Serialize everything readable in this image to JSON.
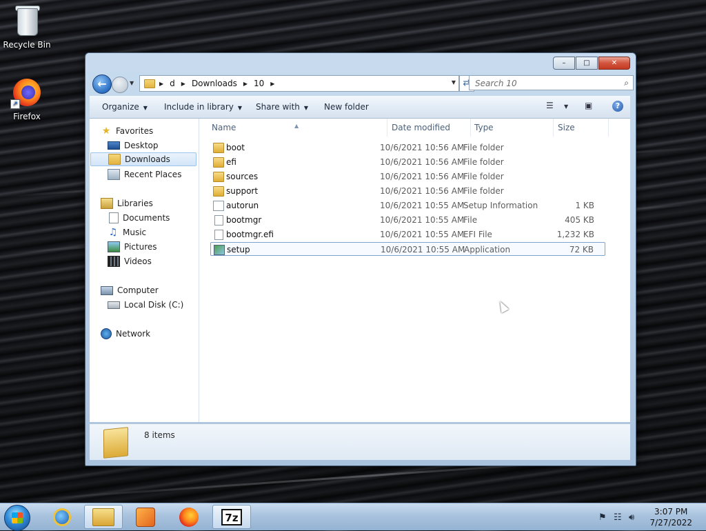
{
  "desktop": {
    "icons": [
      {
        "label": "Recycle Bin",
        "icon": "recycle-bin-icon"
      },
      {
        "label": "Firefox",
        "icon": "firefox-icon"
      }
    ]
  },
  "window": {
    "caption": {
      "min": "–",
      "max": "□",
      "close": "✕"
    },
    "breadcrumb": [
      "d",
      "Downloads",
      "10"
    ],
    "search_placeholder": "Search 10",
    "toolbar": {
      "organize": "Organize",
      "include_in_library": "Include in library",
      "share_with": "Share with",
      "new_folder": "New folder"
    },
    "nav": {
      "favorites": {
        "label": "Favorites",
        "items": [
          "Desktop",
          "Downloads",
          "Recent Places"
        ]
      },
      "libraries": {
        "label": "Libraries",
        "items": [
          "Documents",
          "Music",
          "Pictures",
          "Videos"
        ]
      },
      "computer": {
        "label": "Computer",
        "items": [
          "Local Disk (C:)"
        ]
      },
      "network": {
        "label": "Network"
      },
      "selected": "Downloads"
    },
    "columns": {
      "name": "Name",
      "date": "Date modified",
      "type": "Type",
      "size": "Size"
    },
    "files": [
      {
        "name": "boot",
        "date": "10/6/2021 10:56 AM",
        "type": "File folder",
        "size": "",
        "icon": "folder-icon"
      },
      {
        "name": "efi",
        "date": "10/6/2021 10:56 AM",
        "type": "File folder",
        "size": "",
        "icon": "folder-icon"
      },
      {
        "name": "sources",
        "date": "10/6/2021 10:56 AM",
        "type": "File folder",
        "size": "",
        "icon": "folder-icon"
      },
      {
        "name": "support",
        "date": "10/6/2021 10:56 AM",
        "type": "File folder",
        "size": "",
        "icon": "folder-icon"
      },
      {
        "name": "autorun",
        "date": "10/6/2021 10:55 AM",
        "type": "Setup Information",
        "size": "1 KB",
        "icon": "setup-info-icon"
      },
      {
        "name": "bootmgr",
        "date": "10/6/2021 10:55 AM",
        "type": "File",
        "size": "405 KB",
        "icon": "file-icon"
      },
      {
        "name": "bootmgr.efi",
        "date": "10/6/2021 10:55 AM",
        "type": "EFI File",
        "size": "1,232 KB",
        "icon": "file-icon"
      },
      {
        "name": "setup",
        "date": "10/6/2021 10:55 AM",
        "type": "Application",
        "size": "72 KB",
        "icon": "application-icon",
        "selected": true
      }
    ],
    "status": {
      "items_count": "8 items"
    }
  },
  "taskbar": {
    "apps": [
      "internet-explorer-icon",
      "windows-explorer-icon",
      "media-player-icon",
      "firefox-icon",
      "7zip-icon"
    ],
    "zip_label": "7z",
    "clock": {
      "time": "3:07 PM",
      "date": "7/27/2022"
    }
  }
}
